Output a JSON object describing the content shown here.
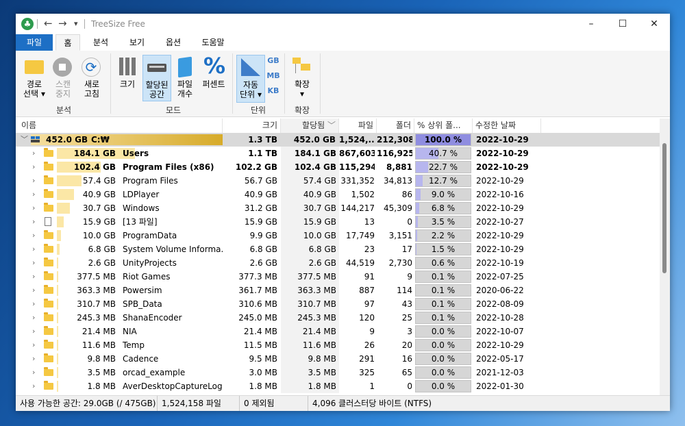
{
  "window": {
    "title": "TreeSize Free",
    "controls": {
      "minimize": "–",
      "maximize": "☐",
      "close": "✕"
    }
  },
  "menu_tabs": [
    "파일",
    "홈",
    "분석",
    "보기",
    "옵션",
    "도움말"
  ],
  "ribbon": {
    "path_select": {
      "line1": "경로",
      "line2": "선택"
    },
    "scan_stop": {
      "line1": "스캔",
      "line2": "중지"
    },
    "refresh": {
      "line1": "새로",
      "line2": "고침"
    },
    "group_analysis": "분석",
    "size": "크기",
    "allocated": {
      "line1": "할당된",
      "line2": "공간"
    },
    "file_count": {
      "line1": "파일",
      "line2": "개수"
    },
    "percent": "퍼센트",
    "group_mode": "모드",
    "auto_unit": {
      "line1": "자동",
      "line2": "단위"
    },
    "unit_gb": "GB",
    "unit_mb": "MB",
    "unit_kb": "KB",
    "group_unit": "단위",
    "expand": "확장",
    "group_expand": "확장"
  },
  "columns": {
    "name": "이름",
    "size": "크기",
    "allocated": "할당됨",
    "files": "파일",
    "folders": "폴더",
    "percent": "% 상위 폴...",
    "modified": "수정한 날짜"
  },
  "root": {
    "size_label": "452.0 GB",
    "name": "C:₩",
    "size": "1.3 TB",
    "allocated": "452.0 GB",
    "files": "1,524,...",
    "folders": "212,308",
    "percent": "100.0 %",
    "pct_value": 1.0,
    "date": "2022-10-29"
  },
  "rows": [
    {
      "size_label": "184.1 GB",
      "name": "Users",
      "size": "1.1 TB",
      "allocated": "184.1 GB",
      "files": "867,603",
      "folders": "116,925",
      "percent": "40.7 %",
      "pct_value": 0.407,
      "date": "2022-10-29",
      "bold": true,
      "type": "folder"
    },
    {
      "size_label": "102.4 GB",
      "name": "Program Files (x86)",
      "size": "102.2 GB",
      "allocated": "102.4 GB",
      "files": "115,294",
      "folders": "8,881",
      "percent": "22.7 %",
      "pct_value": 0.227,
      "date": "2022-10-29",
      "bold": true,
      "type": "folder"
    },
    {
      "size_label": "57.4 GB",
      "name": "Program Files",
      "size": "56.7 GB",
      "allocated": "57.4 GB",
      "files": "331,352",
      "folders": "34,813",
      "percent": "12.7 %",
      "pct_value": 0.127,
      "date": "2022-10-29",
      "bold": false,
      "type": "folder"
    },
    {
      "size_label": "40.9 GB",
      "name": "LDPlayer",
      "size": "40.9 GB",
      "allocated": "40.9 GB",
      "files": "1,502",
      "folders": "86",
      "percent": "9.0 %",
      "pct_value": 0.09,
      "date": "2022-10-16",
      "bold": false,
      "type": "folder"
    },
    {
      "size_label": "30.7 GB",
      "name": "Windows",
      "size": "31.2 GB",
      "allocated": "30.7 GB",
      "files": "144,217",
      "folders": "45,309",
      "percent": "6.8 %",
      "pct_value": 0.068,
      "date": "2022-10-29",
      "bold": false,
      "type": "folder"
    },
    {
      "size_label": "15.9 GB",
      "name": "[13 파일]",
      "size": "15.9 GB",
      "allocated": "15.9 GB",
      "files": "13",
      "folders": "0",
      "percent": "3.5 %",
      "pct_value": 0.035,
      "date": "2022-10-27",
      "bold": false,
      "type": "file"
    },
    {
      "size_label": "10.0 GB",
      "name": "ProgramData",
      "size": "9.9 GB",
      "allocated": "10.0 GB",
      "files": "17,749",
      "folders": "3,151",
      "percent": "2.2 %",
      "pct_value": 0.022,
      "date": "2022-10-29",
      "bold": false,
      "type": "folder"
    },
    {
      "size_label": "6.8 GB",
      "name": "System Volume Informa...",
      "size": "6.8 GB",
      "allocated": "6.8 GB",
      "files": "23",
      "folders": "17",
      "percent": "1.5 %",
      "pct_value": 0.015,
      "date": "2022-10-29",
      "bold": false,
      "type": "folder"
    },
    {
      "size_label": "2.6 GB",
      "name": "UnityProjects",
      "size": "2.6 GB",
      "allocated": "2.6 GB",
      "files": "44,519",
      "folders": "2,730",
      "percent": "0.6 %",
      "pct_value": 0.006,
      "date": "2022-10-19",
      "bold": false,
      "type": "folder"
    },
    {
      "size_label": "377.5 MB",
      "name": "Riot Games",
      "size": "377.3 MB",
      "allocated": "377.5 MB",
      "files": "91",
      "folders": "9",
      "percent": "0.1 %",
      "pct_value": 0.001,
      "date": "2022-07-25",
      "bold": false,
      "type": "folder"
    },
    {
      "size_label": "363.3 MB",
      "name": "Powersim",
      "size": "361.7 MB",
      "allocated": "363.3 MB",
      "files": "887",
      "folders": "114",
      "percent": "0.1 %",
      "pct_value": 0.001,
      "date": "2020-06-22",
      "bold": false,
      "type": "folder"
    },
    {
      "size_label": "310.7 MB",
      "name": "SPB_Data",
      "size": "310.6 MB",
      "allocated": "310.7 MB",
      "files": "97",
      "folders": "43",
      "percent": "0.1 %",
      "pct_value": 0.001,
      "date": "2022-08-09",
      "bold": false,
      "type": "folder"
    },
    {
      "size_label": "245.3 MB",
      "name": "ShanaEncoder",
      "size": "245.0 MB",
      "allocated": "245.3 MB",
      "files": "120",
      "folders": "25",
      "percent": "0.1 %",
      "pct_value": 0.001,
      "date": "2022-10-28",
      "bold": false,
      "type": "folder"
    },
    {
      "size_label": "21.4 MB",
      "name": "NIA",
      "size": "21.4 MB",
      "allocated": "21.4 MB",
      "files": "9",
      "folders": "3",
      "percent": "0.0 %",
      "pct_value": 0.0,
      "date": "2022-10-07",
      "bold": false,
      "type": "folder"
    },
    {
      "size_label": "11.6 MB",
      "name": "Temp",
      "size": "11.5 MB",
      "allocated": "11.6 MB",
      "files": "26",
      "folders": "20",
      "percent": "0.0 %",
      "pct_value": 0.0,
      "date": "2022-10-29",
      "bold": false,
      "type": "folder"
    },
    {
      "size_label": "9.8 MB",
      "name": "Cadence",
      "size": "9.5 MB",
      "allocated": "9.8 MB",
      "files": "291",
      "folders": "16",
      "percent": "0.0 %",
      "pct_value": 0.0,
      "date": "2022-05-17",
      "bold": false,
      "type": "folder"
    },
    {
      "size_label": "3.5 MB",
      "name": "orcad_example",
      "size": "3.0 MB",
      "allocated": "3.5 MB",
      "files": "325",
      "folders": "65",
      "percent": "0.0 %",
      "pct_value": 0.0,
      "date": "2021-12-03",
      "bold": false,
      "type": "folder"
    },
    {
      "size_label": "1.8 MB",
      "name": "AverDesktopCaptureLog",
      "size": "1.8 MB",
      "allocated": "1.8 MB",
      "files": "1",
      "folders": "0",
      "percent": "0.0 %",
      "pct_value": 0.0,
      "date": "2022-01-30",
      "bold": false,
      "type": "folder"
    }
  ],
  "status": {
    "free_space": "사용 가능한 공간: 29.0GB  (/ 475GB)",
    "file_count": "1,524,158 파일",
    "excluded": "0 제외됨",
    "cluster": "4,096 클러스터당 바이트 (NTFS)"
  }
}
